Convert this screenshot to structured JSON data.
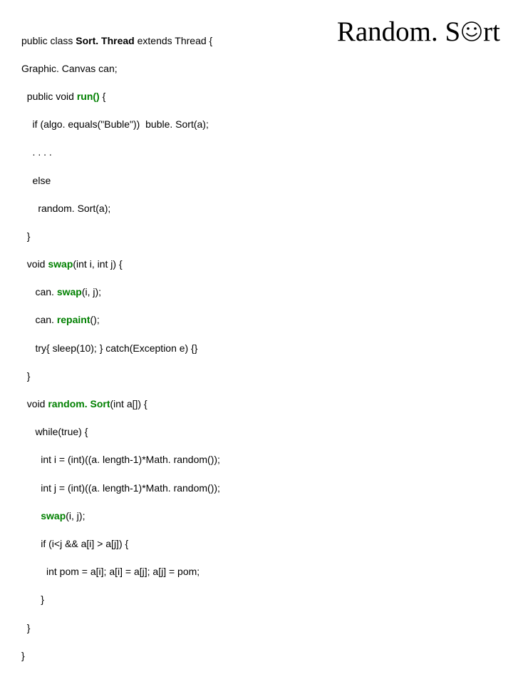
{
  "code": {
    "l1a": "public class ",
    "l1b": "Sort. Thread",
    "l1c": " extends Thread {",
    "l2": "Graphic. Canvas can;",
    "l3a": "  public void ",
    "l3b": "run()",
    "l3c": " {",
    "l4": "    if (algo. equals(\"Buble\"))  buble. Sort(a);",
    "l5": "    . . . .",
    "l6": "    else",
    "l7": "      random. Sort(a);",
    "l8": "  }",
    "l9a": "  void ",
    "l9b": "swap",
    "l9c": "(int i, int j) {",
    "l10a": "     can. ",
    "l10b": "swap",
    "l10c": "(i, j);",
    "l11a": "     can. ",
    "l11b": "repaint",
    "l11c": "();",
    "l12": "     try{ sleep(10); } catch(Exception e) {}",
    "l13": "  }",
    "l14a": "  void ",
    "l14b": "random. Sort",
    "l14c": "(int a[]) {",
    "l15": "     while(true) {",
    "l16": "       int i = (int)((a. length-1)*Math. random());",
    "l17": "       int j = (int)((a. length-1)*Math. random());",
    "l18a": "       ",
    "l18b": "swap",
    "l18c": "(i, j);",
    "l19": "       if (i<j && a[i] > a[j]) {",
    "l20": "         int pom = a[i]; a[i] = a[j]; a[j] = pom;",
    "l21": "       }",
    "l22": "  }",
    "l23": "}"
  },
  "title": {
    "part1": "Random. S",
    "part2": "rt"
  }
}
